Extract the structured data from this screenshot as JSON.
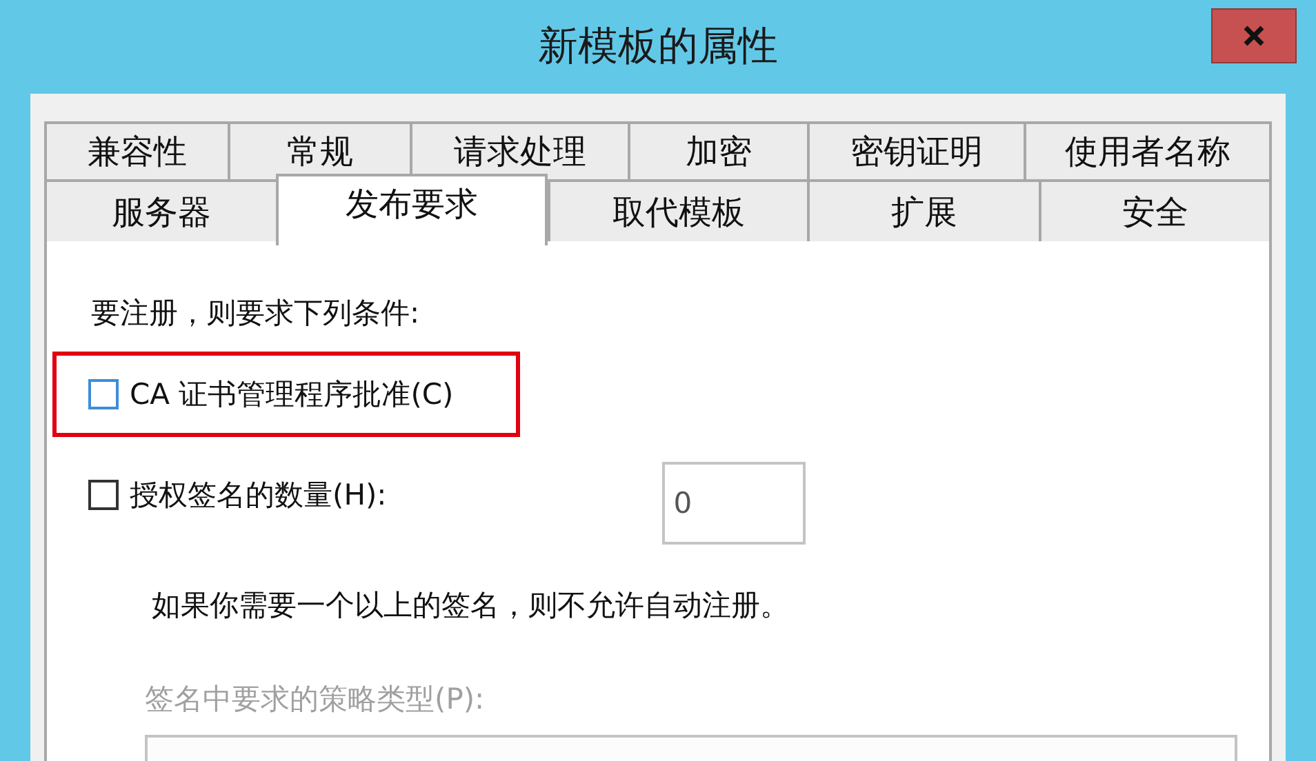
{
  "window": {
    "title": "新模板的属性"
  },
  "tab_rows": [
    [
      {
        "label": "兼容性",
        "selected": false
      },
      {
        "label": "常规",
        "selected": false
      },
      {
        "label": "请求处理",
        "selected": false
      },
      {
        "label": "加密",
        "selected": false
      },
      {
        "label": "密钥证明",
        "selected": false
      },
      {
        "label": "使用者名称",
        "selected": false
      }
    ],
    [
      {
        "label": "服务器",
        "selected": false
      },
      {
        "label": "发布要求",
        "selected": true
      },
      {
        "label": "取代模板",
        "selected": false
      },
      {
        "label": "扩展",
        "selected": false
      },
      {
        "label": "安全",
        "selected": false
      }
    ]
  ],
  "intro": "要注册，则要求下列条件:",
  "ca_approval": {
    "label": "CA 证书管理程序批准(C)",
    "checked": false,
    "highlighted": true
  },
  "signature_count": {
    "label": "授权签名的数量(H):",
    "checked": false,
    "value": "0"
  },
  "note": "如果你需要一个以上的签名，则不允许自动注册。",
  "policy_type": {
    "label": "签名中要求的策略类型(P):",
    "disabled": true
  }
}
